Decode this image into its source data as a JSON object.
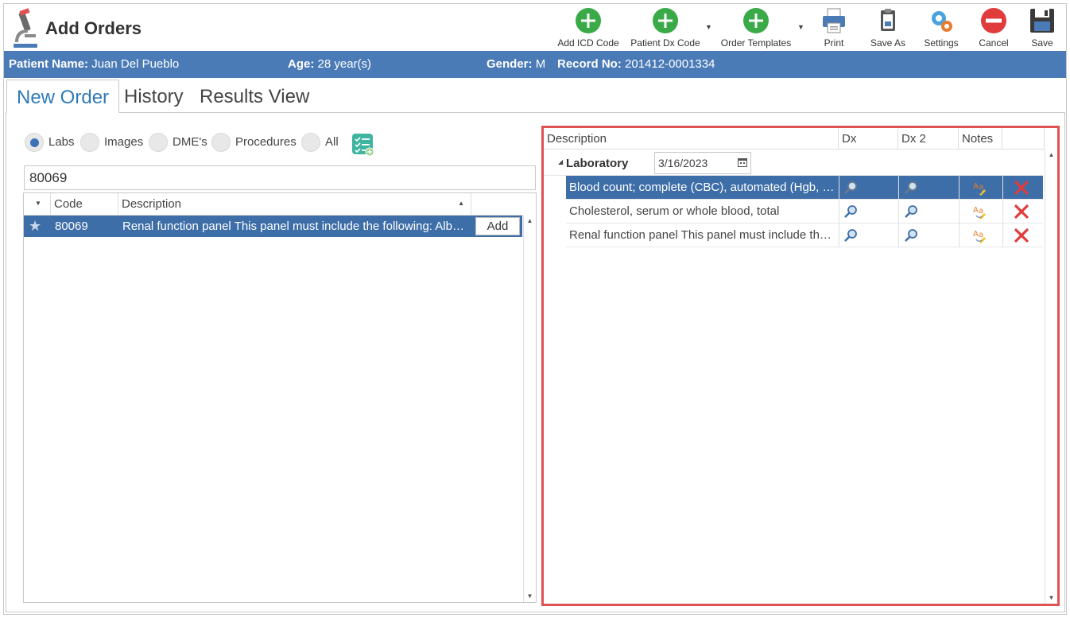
{
  "header": {
    "title": "Add Orders"
  },
  "toolbar": {
    "add_icd": "Add ICD Code",
    "patient_dx": "Patient Dx Code",
    "order_templates": "Order Templates",
    "print": "Print",
    "save_as": "Save As",
    "settings": "Settings",
    "cancel": "Cancel",
    "save": "Save"
  },
  "patient": {
    "name_label": "Patient Name:",
    "name": "Juan Del Pueblo",
    "age_label": "Age:",
    "age": "28 year(s)",
    "gender_label": "Gender:",
    "gender": "M",
    "record_label": "Record No:",
    "record": "201412-0001334"
  },
  "tabs": {
    "new_order": "New Order",
    "history": "History",
    "results_view": "Results View"
  },
  "filters": {
    "labs": "Labs",
    "images": "Images",
    "dmes": "DME's",
    "procedures": "Procedures",
    "all": "All"
  },
  "search": {
    "value": "80069"
  },
  "left_grid": {
    "headers": {
      "code": "Code",
      "description": "Description"
    },
    "rows": [
      {
        "code": "80069",
        "description": "Renal function panel This panel must include the following: Albumin",
        "action": "Add"
      }
    ]
  },
  "right_grid": {
    "headers": {
      "description": "Description",
      "dx": "Dx",
      "dx2": "Dx 2",
      "notes": "Notes"
    },
    "group": {
      "label": "Laboratory",
      "date": "3/16/2023"
    },
    "rows": [
      {
        "description": "Blood count; complete (CBC), automated (Hgb, Hct, RBC, WBC and platelet count)"
      },
      {
        "description": "Cholesterol, serum or whole blood, total"
      },
      {
        "description": "Renal function panel This panel must include the following: Albumin"
      }
    ]
  },
  "colors": {
    "accent": "#4a7bb7",
    "selected_row": "#3d6ea8",
    "highlight_border": "#e05252",
    "add_green": "#3aaa48",
    "cancel_red": "#e03c3c"
  }
}
